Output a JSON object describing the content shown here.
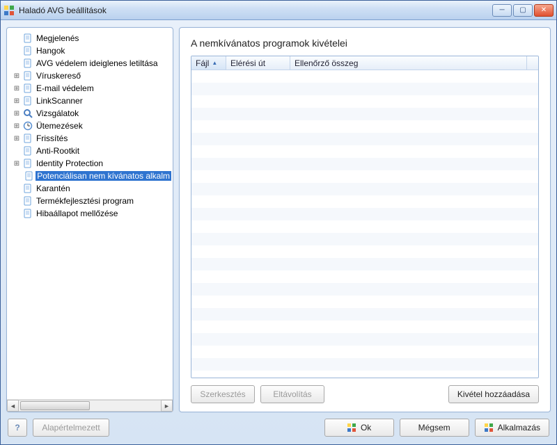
{
  "window": {
    "title": "Haladó AVG beállítások"
  },
  "tree": {
    "items": [
      {
        "label": "Megjelenés",
        "expandable": false,
        "icon": "doc"
      },
      {
        "label": "Hangok",
        "expandable": false,
        "icon": "doc"
      },
      {
        "label": "AVG védelem ideiglenes letiltása",
        "expandable": false,
        "icon": "doc"
      },
      {
        "label": "Víruskereső",
        "expandable": true,
        "icon": "doc"
      },
      {
        "label": "E-mail védelem",
        "expandable": true,
        "icon": "doc"
      },
      {
        "label": "LinkScanner",
        "expandable": true,
        "icon": "doc"
      },
      {
        "label": "Vizsgálatok",
        "expandable": true,
        "icon": "magnifier"
      },
      {
        "label": "Ütemezések",
        "expandable": true,
        "icon": "clock"
      },
      {
        "label": "Frissítés",
        "expandable": true,
        "icon": "doc"
      },
      {
        "label": "Anti-Rootkit",
        "expandable": false,
        "icon": "doc"
      },
      {
        "label": "Identity Protection",
        "expandable": true,
        "icon": "doc"
      },
      {
        "label": "Potenciálisan nem kívánatos alkalm",
        "expandable": false,
        "icon": "doc",
        "selected": true,
        "child": true
      },
      {
        "label": "Karantén",
        "expandable": false,
        "icon": "doc"
      },
      {
        "label": "Termékfejlesztési program",
        "expandable": false,
        "icon": "doc"
      },
      {
        "label": "Hibaállapot mellőzése",
        "expandable": false,
        "icon": "doc"
      }
    ]
  },
  "content": {
    "title": "A nemkívánatos programok kivételei",
    "columns": {
      "file": "Fájl",
      "path": "Elérési út",
      "checksum": "Ellenőrző összeg"
    },
    "buttons": {
      "edit": "Szerkesztés",
      "remove": "Eltávolítás",
      "add": "Kivétel hozzáadása"
    }
  },
  "bottom": {
    "defaults": "Alapértelmezett",
    "ok": "Ok",
    "cancel": "Mégsem",
    "apply": "Alkalmazás"
  }
}
